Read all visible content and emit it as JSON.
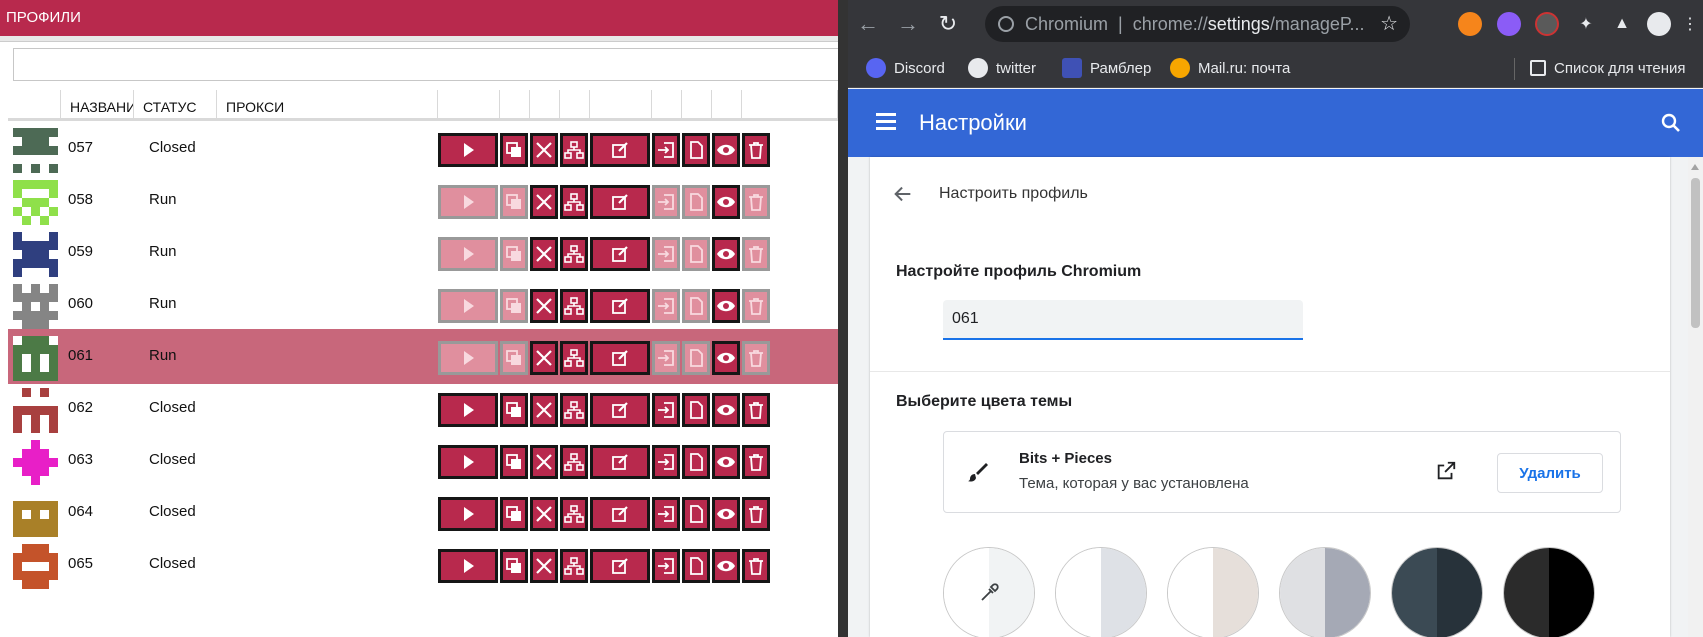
{
  "left_app": {
    "title": "ПРОФИЛИ",
    "search_value": "",
    "columns": [
      "НАЗВАНИЕ",
      "СТАТУС",
      "ПРОКСИ"
    ],
    "rows": [
      {
        "name": "057",
        "status": "Closed",
        "color": "#4d6a55",
        "shape": "a",
        "active": false,
        "selected": false
      },
      {
        "name": "058",
        "status": "Run",
        "color": "#8fe04a",
        "shape": "b",
        "active": true,
        "selected": false
      },
      {
        "name": "059",
        "status": "Run",
        "color": "#2f3f7f",
        "shape": "c",
        "active": true,
        "selected": false
      },
      {
        "name": "060",
        "status": "Run",
        "color": "#858585",
        "shape": "d",
        "active": true,
        "selected": false
      },
      {
        "name": "061",
        "status": "Run",
        "color": "#4c7a46",
        "shape": "e",
        "active": true,
        "selected": true
      },
      {
        "name": "062",
        "status": "Closed",
        "color": "#a8403f",
        "shape": "f",
        "active": false,
        "selected": false
      },
      {
        "name": "063",
        "status": "Closed",
        "color": "#e81fc7",
        "shape": "g",
        "active": false,
        "selected": false
      },
      {
        "name": "064",
        "status": "Closed",
        "color": "#a98028",
        "shape": "h",
        "active": false,
        "selected": false
      },
      {
        "name": "065",
        "status": "Closed",
        "color": "#c4532a",
        "shape": "i",
        "active": false,
        "selected": false
      }
    ],
    "action_icons": [
      "play-icon",
      "copy-run-icon",
      "close-icon",
      "network-icon",
      "edit-icon",
      "login-icon",
      "file-icon",
      "eye-icon",
      "trash-icon"
    ],
    "accent_color": "#b8294d",
    "selected_row_color": "#c8677b"
  },
  "browser": {
    "omnibox": {
      "prefix": "Chromium",
      "separator": "|",
      "url_scheme": "chrome://",
      "url_host": "settings",
      "url_path": "/manageP..."
    },
    "bookmarks": [
      {
        "label": "Discord",
        "icon": "discord-icon",
        "color": "#5865f2"
      },
      {
        "label": "twitter",
        "icon": "globe-icon",
        "color": "#e8eaed"
      },
      {
        "label": "Рамблер",
        "icon": "mail-icon",
        "color": "#3f51b5"
      },
      {
        "label": "Mail.ru: почта",
        "icon": "at-icon",
        "color": "#f7a600"
      }
    ],
    "reading_list": "Список для чтения",
    "extensions": [
      "metamask-icon",
      "alien-icon",
      "spy-icon",
      "puzzle-icon",
      "flask-icon",
      "profile-avatar-icon",
      "more-menu-icon"
    ]
  },
  "settings": {
    "title": "Настройки",
    "subtitle": "Настроить профиль",
    "profile_label": "Настройте профиль Chromium",
    "profile_name": "061",
    "colors_label": "Выберите цвета темы",
    "theme_name": "Bits + Pieces",
    "theme_desc": "Тема, которая у вас установлена",
    "delete_label": "Удалить",
    "header_color": "#3367d6",
    "swatches": [
      {
        "left": "#ffffff",
        "right": "#f1f3f4",
        "picker": true
      },
      {
        "left": "#ffffff",
        "right": "#dee1e6",
        "picker": false
      },
      {
        "left": "#ffffff",
        "right": "#e6dfda",
        "picker": false
      },
      {
        "left": "#dfe0e3",
        "right": "#a5a9b5",
        "picker": false
      },
      {
        "left": "#3b4a54",
        "right": "#27323a",
        "picker": false
      },
      {
        "left": "#2b2b2b",
        "right": "#000000",
        "picker": false
      }
    ]
  }
}
